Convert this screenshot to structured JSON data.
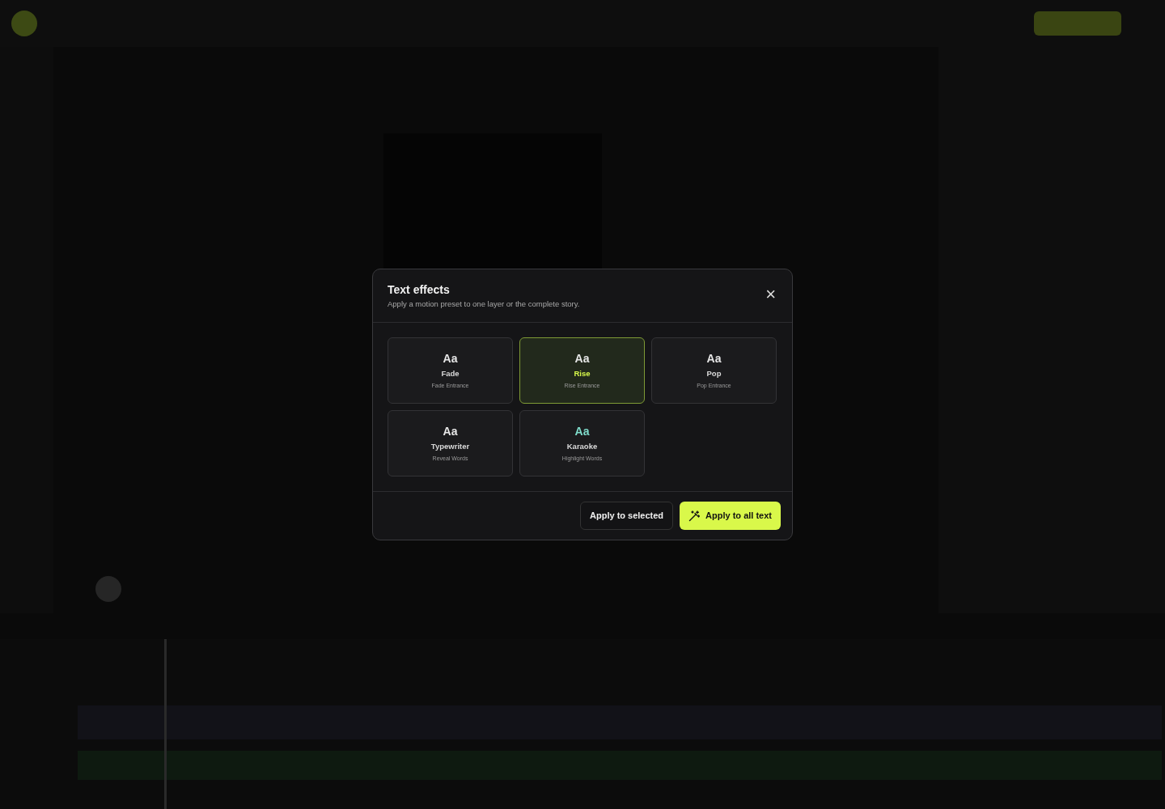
{
  "dialog": {
    "title": "Text effects",
    "subtitle": "Apply a motion preset to one layer or the complete story.",
    "close": "×",
    "presets": [
      {
        "sample": "Aa",
        "name": "Fade",
        "description": "Fade Entrance",
        "selected": false,
        "color": "#e6e6e6"
      },
      {
        "sample": "Aa",
        "name": "Rise",
        "description": "Rise Entrance",
        "selected": true,
        "color": "#e6e6e6"
      },
      {
        "sample": "Aa",
        "name": "Pop",
        "description": "Pop Entrance",
        "selected": false,
        "color": "#e6e6e6"
      },
      {
        "sample": "Aa",
        "name": "Typewriter",
        "description": "Reveal Words",
        "selected": false,
        "color": "#e6e6e6"
      },
      {
        "sample": "Aa",
        "name": "Karaoke",
        "description": "Highlight Words",
        "selected": false,
        "color": "#7fdccb"
      }
    ],
    "buttons": [
      {
        "label": "Apply to selected",
        "kind": "secondary"
      },
      {
        "label": "Apply to all text",
        "kind": "primary"
      }
    ]
  }
}
